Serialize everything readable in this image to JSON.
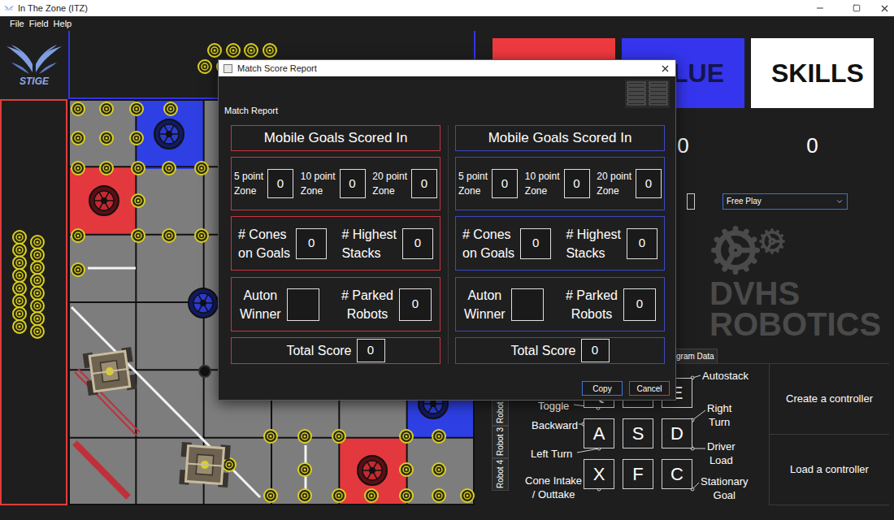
{
  "window": {
    "title": "In The Zone (ITZ)"
  },
  "menu": [
    "File",
    "Field",
    "Help"
  ],
  "logo": {
    "text": "STIGE"
  },
  "scoreboard": [
    {
      "color": "#ee3a3f"
    },
    {
      "label": "LUE",
      "score": "0",
      "color": "#3535ee"
    },
    {
      "label": "SKILLS",
      "score": "0",
      "color": "#ffffff"
    }
  ],
  "mode_select": {
    "value": "Free Play"
  },
  "watermark": {
    "lines": [
      "DVHS",
      "ROBOTICS"
    ]
  },
  "panel_tabs": {
    "visible_label": "gram Data"
  },
  "robot_tabs": [
    "Robot 2",
    "Robot 3",
    "Robot 4"
  ],
  "keyboard": {
    "rows": [
      [
        "Q",
        "W",
        "E"
      ],
      [
        "A",
        "S",
        "D"
      ],
      [
        "X",
        "F",
        "C"
      ]
    ],
    "labels": [
      {
        "lines": [
          "Toggle"
        ]
      },
      {
        "lines": [
          "Backward"
        ]
      },
      {
        "lines": [
          "Left Turn"
        ]
      },
      {
        "lines": [
          "Cone Intake",
          "/ Outtake"
        ]
      },
      {
        "lines": [
          "Autostack"
        ]
      },
      {
        "lines": [
          "Right",
          "Turn"
        ]
      },
      {
        "lines": [
          "Driver",
          "Load"
        ]
      },
      {
        "lines": [
          "Stationary",
          "Goal"
        ]
      }
    ]
  },
  "controller_buttons": [
    "Create a controller",
    "Load a controller"
  ],
  "dialog": {
    "title": "Match Score Report",
    "heading": "Match Report",
    "teams": [
      {
        "color": "#c8363e",
        "header": "Mobile Goals Scored In",
        "zones": [
          {
            "lines": [
              "5 point",
              "Zone"
            ],
            "value": "0"
          },
          {
            "lines": [
              "10 point",
              "Zone"
            ],
            "value": "0"
          },
          {
            "lines": [
              "20 point",
              "Zone"
            ],
            "value": "0"
          }
        ],
        "stats": [
          {
            "lines": [
              "# Cones",
              "on Goals"
            ],
            "value": "0"
          },
          {
            "lines": [
              "# Highest",
              "Stacks"
            ],
            "value": "0"
          }
        ],
        "auton": [
          {
            "lines": [
              "Auton",
              "Winner"
            ],
            "value": ""
          },
          {
            "lines": [
              "# Parked",
              "Robots"
            ],
            "value": "0"
          }
        ],
        "total": {
          "label": "Total Score",
          "value": "0"
        }
      },
      {
        "color": "#3b49c4",
        "header": "Mobile Goals Scored In",
        "zones": [
          {
            "lines": [
              "5 point",
              "Zone"
            ],
            "value": "0"
          },
          {
            "lines": [
              "10 point",
              "Zone"
            ],
            "value": "0"
          },
          {
            "lines": [
              "20 point",
              "Zone"
            ],
            "value": "0"
          }
        ],
        "stats": [
          {
            "lines": [
              "# Cones",
              "on Goals"
            ],
            "value": "0"
          },
          {
            "lines": [
              "# Highest",
              "Stacks"
            ],
            "value": "0"
          }
        ],
        "auton": [
          {
            "lines": [
              "Auton",
              "Winner"
            ],
            "value": ""
          },
          {
            "lines": [
              "# Parked",
              "Robots"
            ],
            "value": "0"
          }
        ],
        "total": {
          "label": "Total Score",
          "value": "0"
        }
      }
    ],
    "buttons": [
      {
        "label": "Copy",
        "color": "#3c78d8"
      },
      {
        "label": "Cancel",
        "color": "#d0343c"
      }
    ]
  }
}
